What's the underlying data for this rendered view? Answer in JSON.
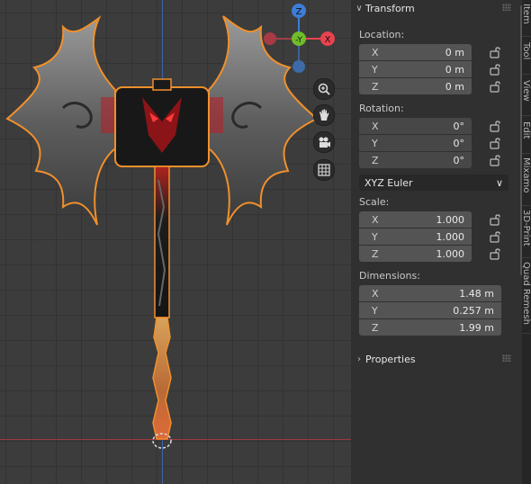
{
  "viewport": {
    "gizmo": {
      "z_label": "Z",
      "neg_y_label": "-Y",
      "x_label": "X"
    },
    "tools": [
      "zoom-icon",
      "hand-pan-icon",
      "camera-icon",
      "grid-ortho-icon"
    ]
  },
  "panel": {
    "transform_title": "Transform",
    "location": {
      "label": "Location:",
      "x": {
        "axis": "X",
        "value": "0 m"
      },
      "y": {
        "axis": "Y",
        "value": "0 m"
      },
      "z": {
        "axis": "Z",
        "value": "0 m"
      }
    },
    "rotation": {
      "label": "Rotation:",
      "x": {
        "axis": "X",
        "value": "0°"
      },
      "y": {
        "axis": "Y",
        "value": "0°"
      },
      "z": {
        "axis": "Z",
        "value": "0°"
      },
      "mode": "XYZ Euler"
    },
    "scale": {
      "label": "Scale:",
      "x": {
        "axis": "X",
        "value": "1.000"
      },
      "y": {
        "axis": "Y",
        "value": "1.000"
      },
      "z": {
        "axis": "Z",
        "value": "1.000"
      }
    },
    "dimensions": {
      "label": "Dimensions:",
      "x": {
        "axis": "X",
        "value": "1.48 m"
      },
      "y": {
        "axis": "Y",
        "value": "0.257 m"
      },
      "z": {
        "axis": "Z",
        "value": "1.99 m"
      }
    },
    "properties_title": "Properties"
  },
  "tabs": [
    "Item",
    "Tool",
    "View",
    "Edit",
    "Mixamo",
    "3D-Print",
    "Quad Remesh"
  ],
  "colors": {
    "x_axis": "#e8434f",
    "y_axis": "#6fbd2a",
    "z_axis": "#3d7dd6",
    "selection": "#f0902c"
  }
}
